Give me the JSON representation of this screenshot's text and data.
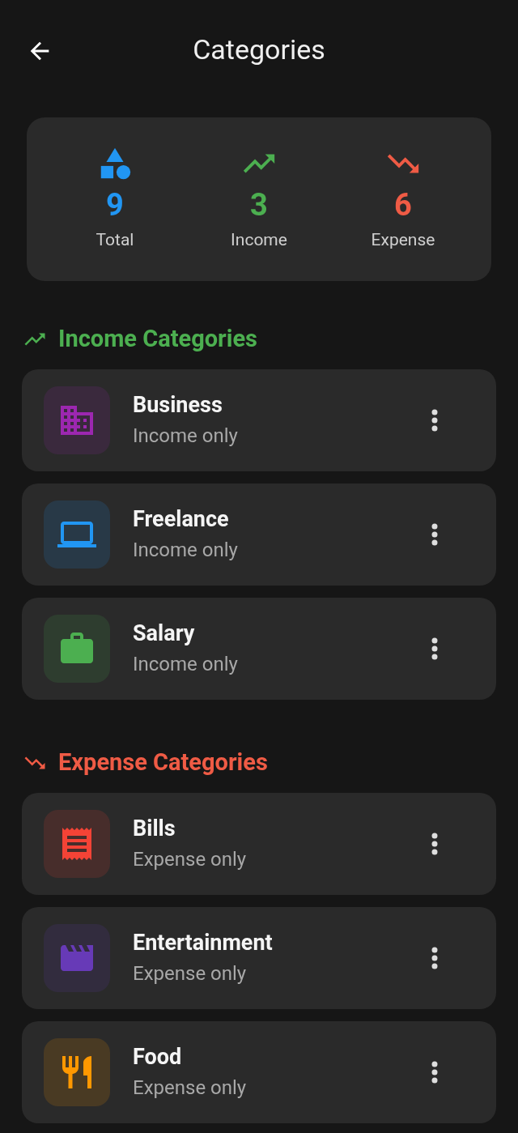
{
  "header": {
    "title": "Categories"
  },
  "summary": [
    {
      "kind": "shapes",
      "value": "9",
      "label": "Total",
      "color": "#2196f3"
    },
    {
      "kind": "up",
      "value": "3",
      "label": "Income",
      "color": "#4caf50"
    },
    {
      "kind": "down",
      "value": "6",
      "label": "Expense",
      "color": "#ef5b45"
    }
  ],
  "sections": [
    {
      "kind": "up",
      "title": "Income Categories",
      "color": "#4caf50",
      "items": [
        {
          "kind": "building",
          "name": "Business",
          "subtitle": "Income only",
          "color": "#9c27b0"
        },
        {
          "kind": "laptop",
          "name": "Freelance",
          "subtitle": "Income only",
          "color": "#2196f3"
        },
        {
          "kind": "briefcase",
          "name": "Salary",
          "subtitle": "Income only",
          "color": "#4caf50"
        }
      ]
    },
    {
      "kind": "down",
      "title": "Expense Categories",
      "color": "#ef5b45",
      "items": [
        {
          "kind": "receipt",
          "name": "Bills",
          "subtitle": "Expense only",
          "color": "#f44336"
        },
        {
          "kind": "clapper",
          "name": "Entertainment",
          "subtitle": "Expense only",
          "color": "#673ab7"
        },
        {
          "kind": "cutlery",
          "name": "Food",
          "subtitle": "Expense only",
          "color": "#ff9800"
        }
      ]
    }
  ]
}
